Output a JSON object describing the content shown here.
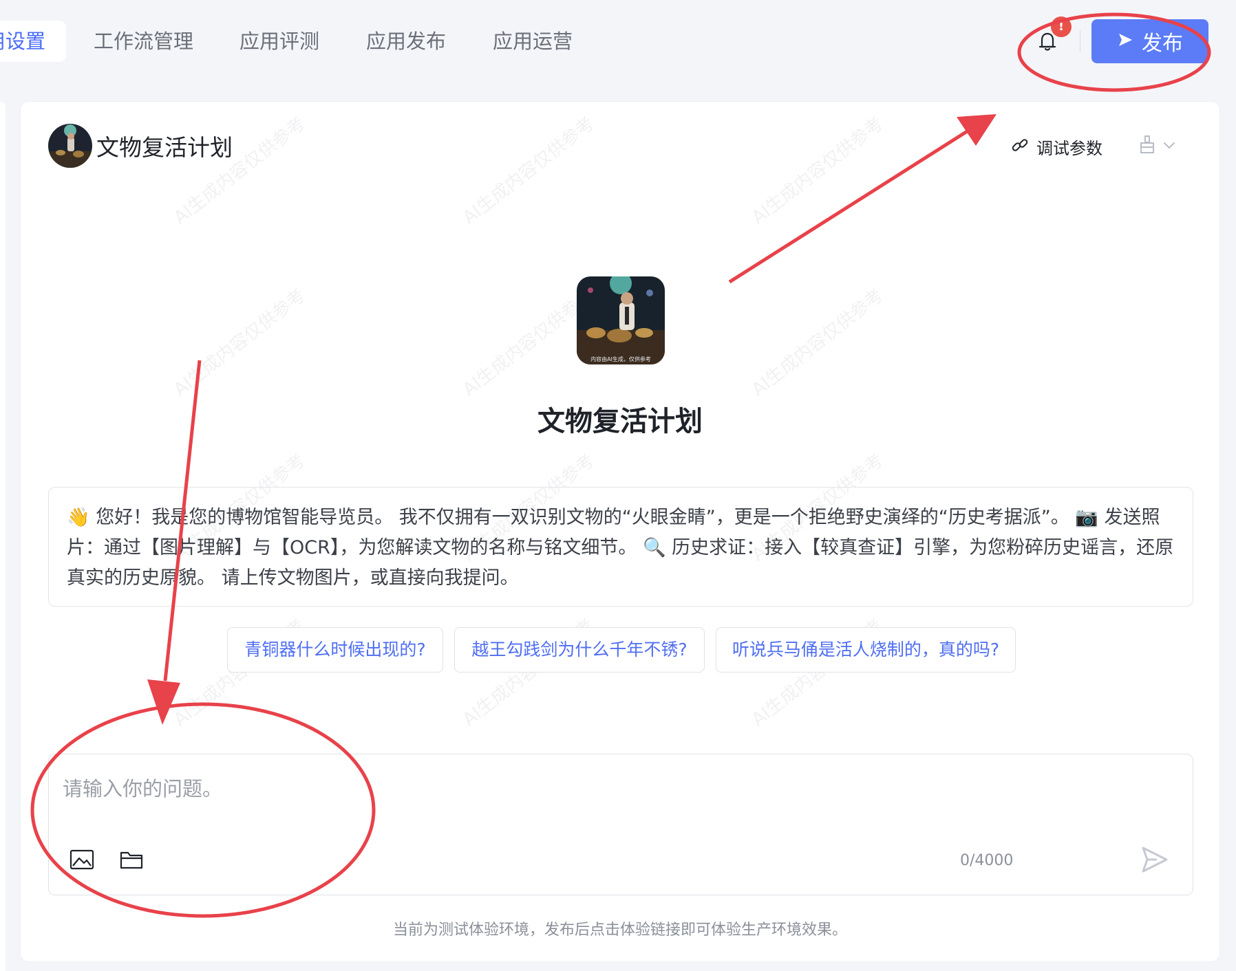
{
  "nav": {
    "tabs": [
      {
        "label": "用设置"
      },
      {
        "label": "工作流管理"
      },
      {
        "label": "应用评测"
      },
      {
        "label": "应用发布"
      },
      {
        "label": "应用运营"
      }
    ],
    "notification_count": "!",
    "publish_label": "发布"
  },
  "header": {
    "title": "文物复活计划",
    "debug_params_label": "调试参数"
  },
  "welcome": {
    "title": "文物复活计划",
    "intro": "👋 您好！我是您的博物馆智能导览员。 我不仅拥有一双识别文物的“火眼金睛”，更是一个拒绝野史演绎的“历史考据派”。 📷 发送照片：通过【图片理解】与【OCR】，为您解读文物的名称与铭文细节。 🔍 历史求证：接入【较真查证】引擎，为您粉碎历史谣言，还原真实的历史原貌。 请上传文物图片，或直接向我提问。",
    "suggestions": [
      "青铜器什么时候出现的?",
      "越王勾践剑为什么千年不锈?",
      "听说兵马俑是活人烧制的，真的吗?"
    ]
  },
  "composer": {
    "placeholder": "请输入你的问题。",
    "value": "",
    "counter": "0/4000"
  },
  "footer_note": "当前为测试体验环境，发布后点击体验链接即可体验生产环境效果。",
  "watermark_text": "AI生成内容仅供参考",
  "avatar_caption": "内容由AI生成，仅供参考",
  "colors": {
    "accent": "#5b7cf6",
    "annotation": "#e8424a"
  }
}
